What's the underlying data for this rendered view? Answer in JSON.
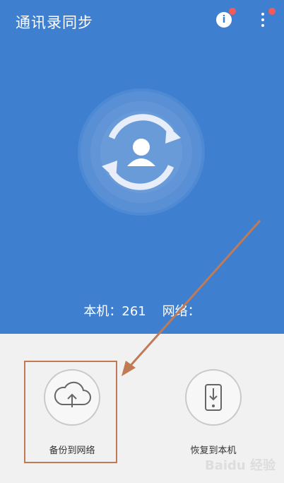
{
  "app": {
    "title": "通讯录同步"
  },
  "header": {
    "info_label": "i"
  },
  "stats": {
    "local_label": "本机：",
    "local_count": "261",
    "network_label": "网络："
  },
  "actions": {
    "backup_label": "备份到网络",
    "restore_label": "恢复到本机"
  },
  "colors": {
    "primary": "#3f7fd0",
    "badge": "#f45a5a",
    "annotation": "#c07a55"
  },
  "icons": {
    "sync": "sync-contact-icon",
    "backup": "cloud-upload-icon",
    "restore": "phone-download-icon",
    "info": "info-icon",
    "more": "more-vertical-icon"
  }
}
